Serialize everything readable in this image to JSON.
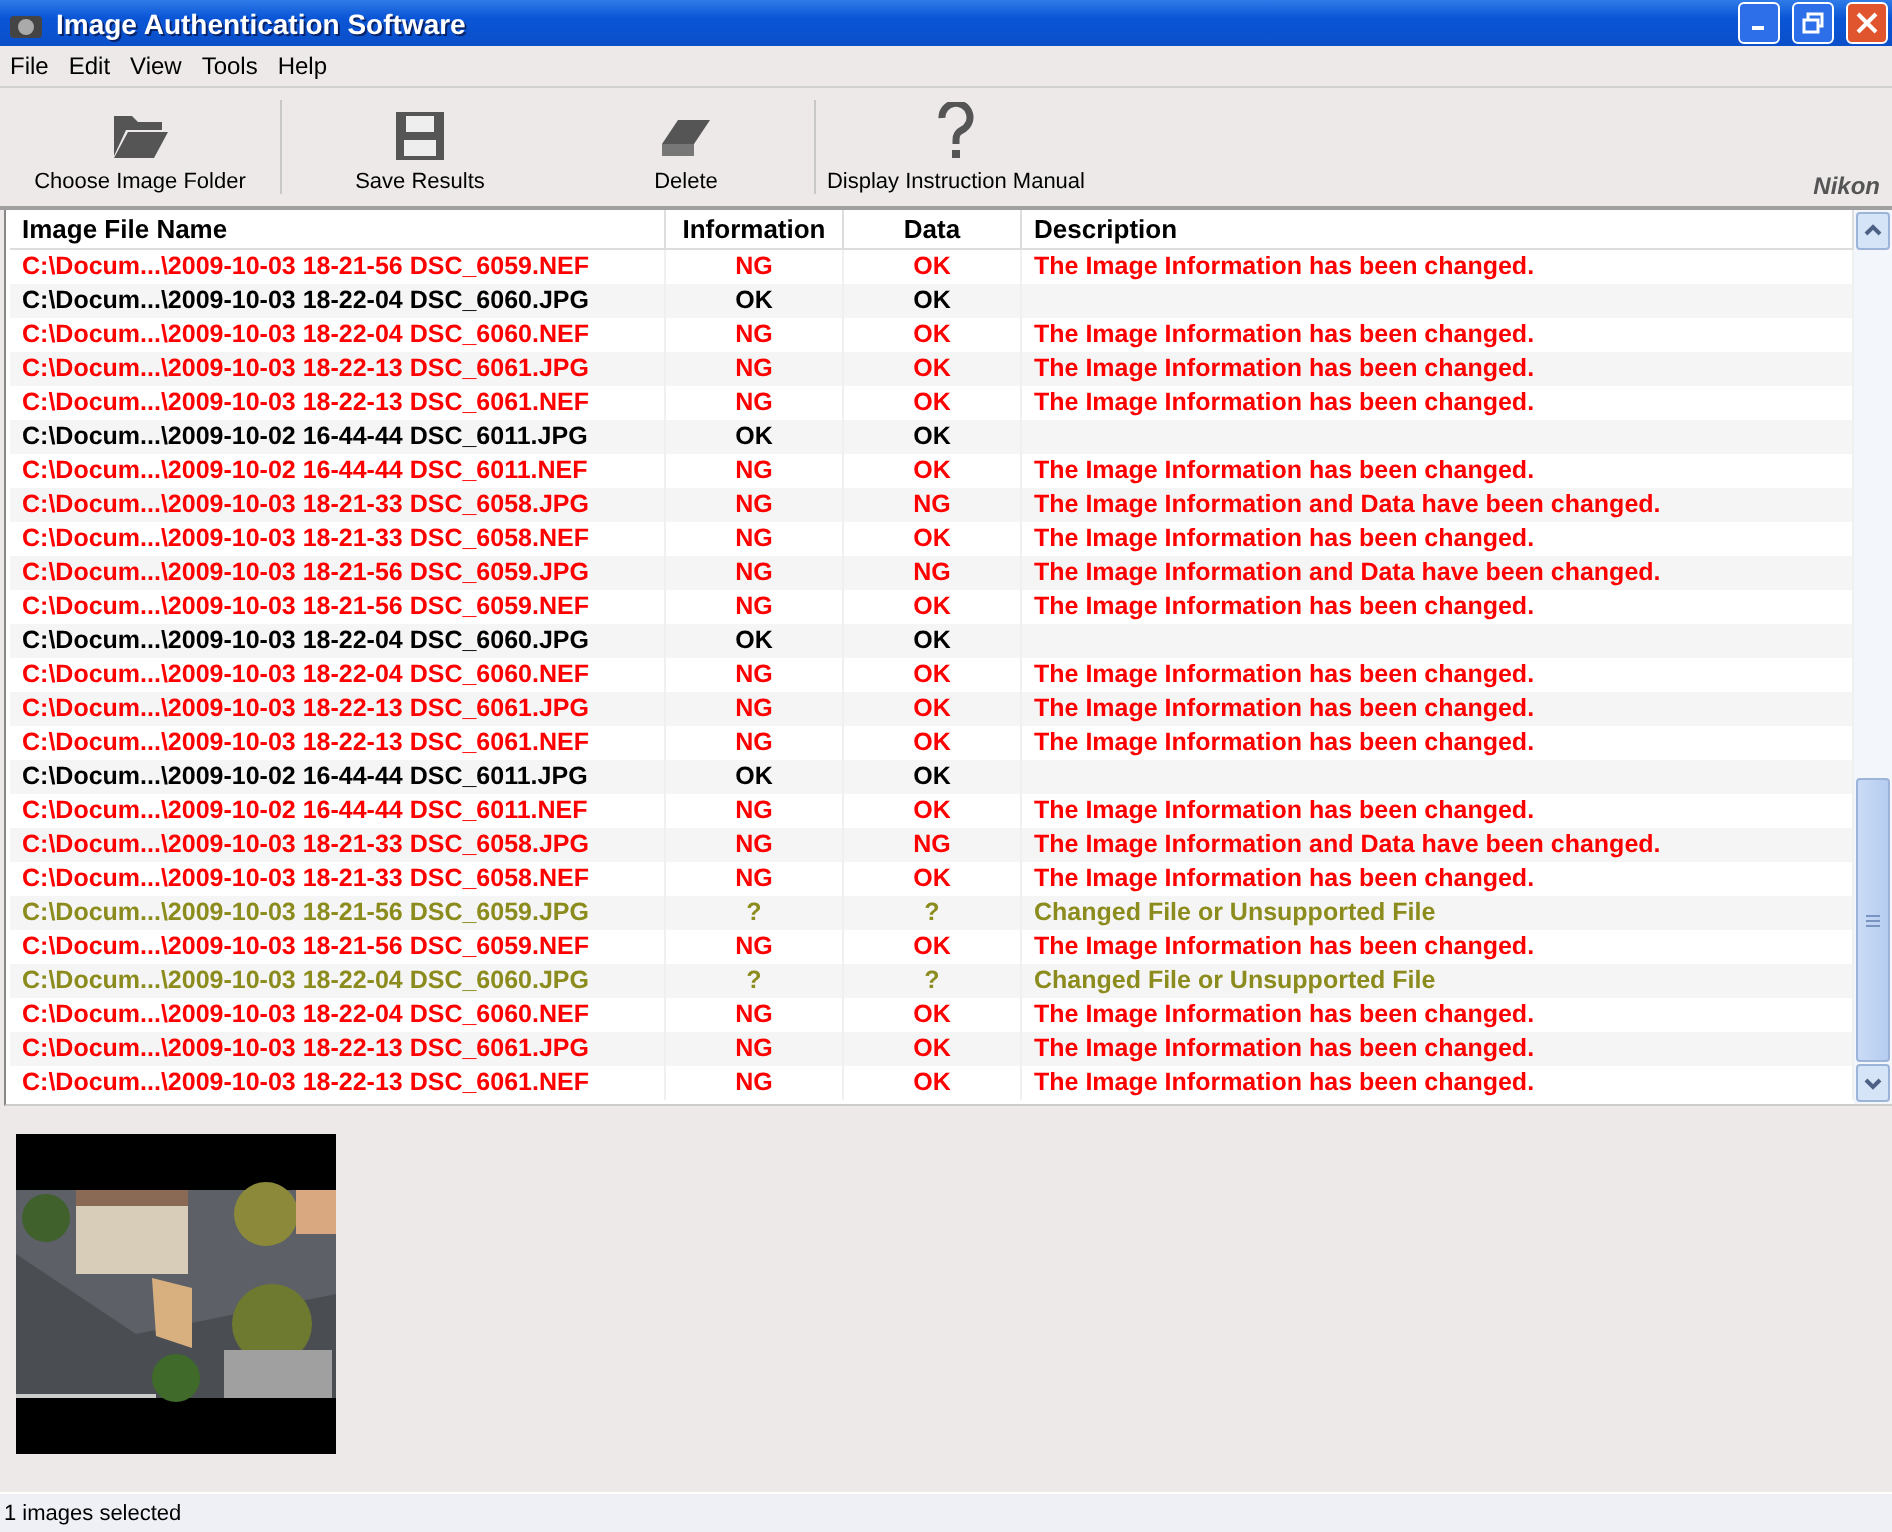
{
  "window": {
    "title": "Image Authentication Software"
  },
  "menu": [
    "File",
    "Edit",
    "View",
    "Tools",
    "Help"
  ],
  "toolbar": [
    {
      "label": "Choose Image Folder",
      "kind": "folder"
    },
    {
      "label": "Save Results",
      "kind": "save"
    },
    {
      "label": "Delete",
      "kind": "eraser"
    },
    {
      "label": "Display Instruction Manual",
      "kind": "help"
    }
  ],
  "brand": "Nikon",
  "table": {
    "columns": [
      "Image File Name",
      "Information",
      "Data",
      "Description"
    ],
    "rows": [
      {
        "file": "C:\\Docum...\\2009-10-03 18-21-56 DSC_6059.NEF",
        "information": "NG",
        "data": "OK",
        "description": "The Image Information has been changed.",
        "color": "#ff0000"
      },
      {
        "file": "C:\\Docum...\\2009-10-03 18-22-04 DSC_6060.JPG",
        "information": "OK",
        "data": "OK",
        "color": "#000000"
      },
      {
        "file": "C:\\Docum...\\2009-10-03 18-22-04 DSC_6060.NEF",
        "information": "NG",
        "data": "OK",
        "description": "The Image Information has been changed.",
        "color": "#ff0000"
      },
      {
        "file": "C:\\Docum...\\2009-10-03 18-22-13 DSC_6061.JPG",
        "information": "NG",
        "data": "OK",
        "description": "The Image Information has been changed.",
        "color": "#ff0000"
      },
      {
        "file": "C:\\Docum...\\2009-10-03 18-22-13 DSC_6061.NEF",
        "information": "NG",
        "data": "OK",
        "description": "The Image Information has been changed.",
        "color": "#ff0000"
      },
      {
        "file": "C:\\Docum...\\2009-10-02 16-44-44 DSC_6011.JPG",
        "information": "OK",
        "data": "OK",
        "color": "#000000"
      },
      {
        "file": "C:\\Docum...\\2009-10-02 16-44-44 DSC_6011.NEF",
        "information": "NG",
        "data": "OK",
        "description": "The Image Information has been changed.",
        "color": "#ff0000"
      },
      {
        "file": "C:\\Docum...\\2009-10-03 18-21-33 DSC_6058.JPG",
        "information": "NG",
        "data": "NG",
        "description": "The Image Information and Data have been changed.",
        "color": "#ff0000"
      },
      {
        "file": "C:\\Docum...\\2009-10-03 18-21-33 DSC_6058.NEF",
        "information": "NG",
        "data": "OK",
        "description": "The Image Information has been changed.",
        "color": "#ff0000"
      },
      {
        "file": "C:\\Docum...\\2009-10-03 18-21-56 DSC_6059.JPG",
        "information": "NG",
        "data": "NG",
        "description": "The Image Information and Data have been changed.",
        "color": "#ff0000"
      },
      {
        "file": "C:\\Docum...\\2009-10-03 18-21-56 DSC_6059.NEF",
        "information": "NG",
        "data": "OK",
        "description": "The Image Information has been changed.",
        "color": "#ff0000"
      },
      {
        "file": "C:\\Docum...\\2009-10-03 18-22-04 DSC_6060.JPG",
        "information": "OK",
        "data": "OK",
        "color": "#000000"
      },
      {
        "file": "C:\\Docum...\\2009-10-03 18-22-04 DSC_6060.NEF",
        "information": "NG",
        "data": "OK",
        "description": "The Image Information has been changed.",
        "color": "#ff0000"
      },
      {
        "file": "C:\\Docum...\\2009-10-03 18-22-13 DSC_6061.JPG",
        "information": "NG",
        "data": "OK",
        "description": "The Image Information has been changed.",
        "color": "#ff0000"
      },
      {
        "file": "C:\\Docum...\\2009-10-03 18-22-13 DSC_6061.NEF",
        "information": "NG",
        "data": "OK",
        "description": "The Image Information has been changed.",
        "color": "#ff0000"
      },
      {
        "file": "C:\\Docum...\\2009-10-02 16-44-44 DSC_6011.JPG",
        "information": "OK",
        "data": "OK",
        "color": "#000000"
      },
      {
        "file": "C:\\Docum...\\2009-10-02 16-44-44 DSC_6011.NEF",
        "information": "NG",
        "data": "OK",
        "description": "The Image Information has been changed.",
        "color": "#ff0000"
      },
      {
        "file": "C:\\Docum...\\2009-10-03 18-21-33 DSC_6058.JPG",
        "information": "NG",
        "data": "NG",
        "description": "The Image Information and Data have been changed.",
        "color": "#ff0000"
      },
      {
        "file": "C:\\Docum...\\2009-10-03 18-21-33 DSC_6058.NEF",
        "information": "NG",
        "data": "OK",
        "description": "The Image Information has been changed.",
        "color": "#ff0000"
      },
      {
        "file": "C:\\Docum...\\2009-10-03 18-21-56 DSC_6059.JPG",
        "information": "?",
        "data": "?",
        "description": "Changed File or Unsupported File",
        "color": "#8c8c1e"
      },
      {
        "file": "C:\\Docum...\\2009-10-03 18-21-56 DSC_6059.NEF",
        "information": "NG",
        "data": "OK",
        "description": "The Image Information has been changed.",
        "color": "#ff0000"
      },
      {
        "file": "C:\\Docum...\\2009-10-03 18-22-04 DSC_6060.JPG",
        "information": "?",
        "data": "?",
        "description": "Changed File or Unsupported File",
        "color": "#8c8c1e"
      },
      {
        "file": "C:\\Docum...\\2009-10-03 18-22-04 DSC_6060.NEF",
        "information": "NG",
        "data": "OK",
        "description": "The Image Information has been changed.",
        "color": "#ff0000"
      },
      {
        "file": "C:\\Docum...\\2009-10-03 18-22-13 DSC_6061.JPG",
        "information": "NG",
        "data": "OK",
        "description": "The Image Information has been changed.",
        "color": "#ff0000"
      },
      {
        "file": "C:\\Docum...\\2009-10-03 18-22-13 DSC_6061.NEF",
        "information": "NG",
        "data": "OK",
        "description": "The Image Information has been changed.",
        "color": "#ff0000"
      }
    ]
  },
  "status_bar": "1 images selected"
}
